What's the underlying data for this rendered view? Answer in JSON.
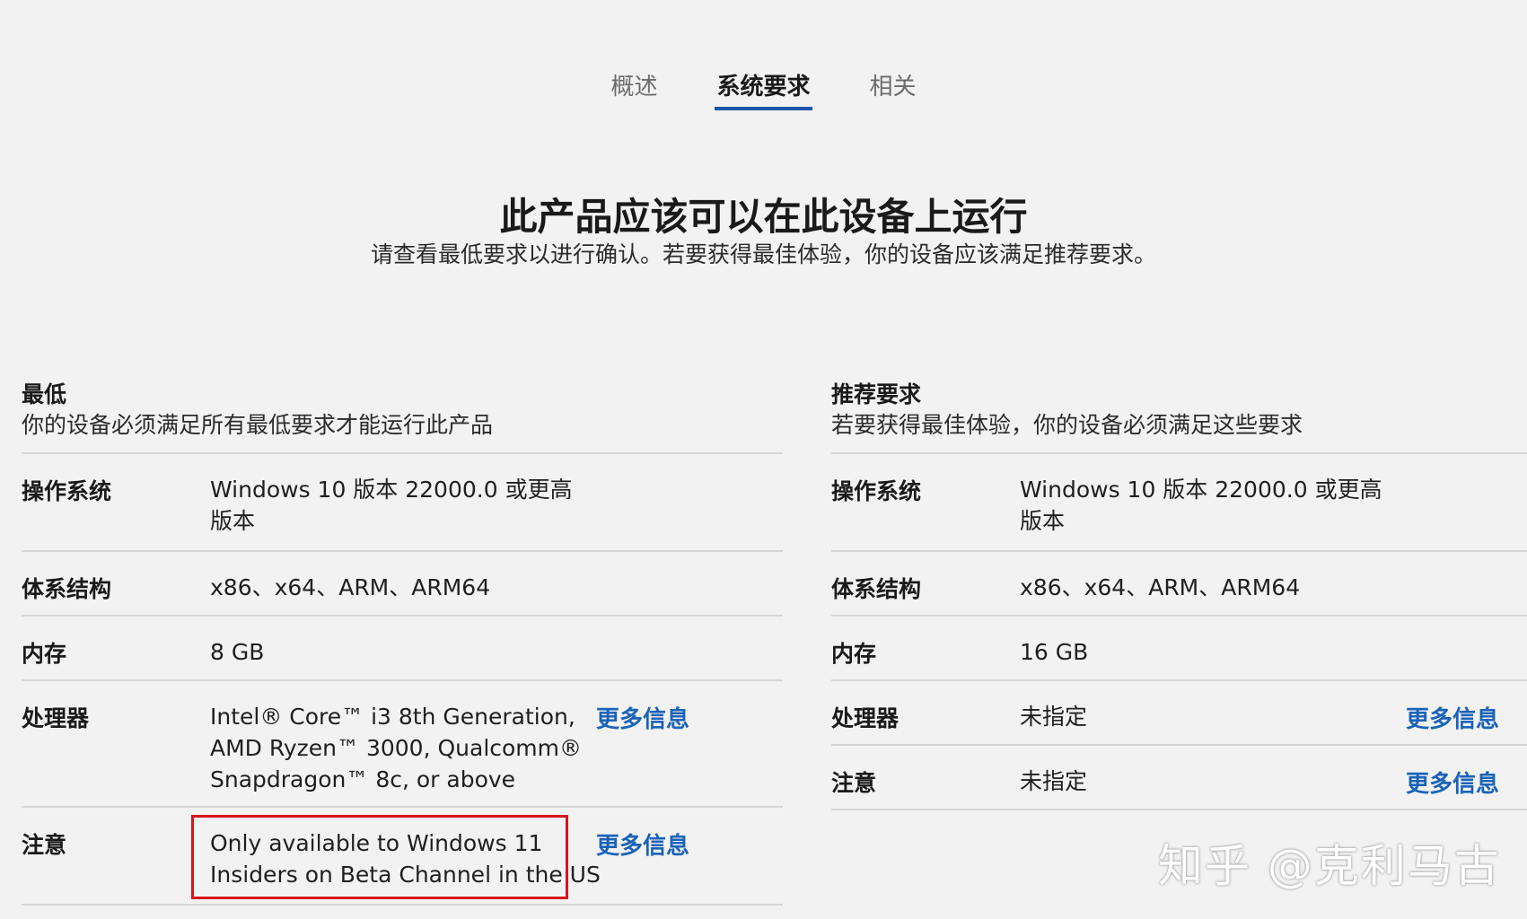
{
  "tabs": [
    {
      "label": "概述",
      "active": false
    },
    {
      "label": "系统要求",
      "active": true
    },
    {
      "label": "相关",
      "active": false
    }
  ],
  "headline": "此产品应该可以在此设备上运行",
  "subhead": "请查看最低要求以进行确认。若要获得最佳体验，你的设备应该满足推荐要求。",
  "minimum": {
    "title": "最低",
    "description": "你的设备必须满足所有最低要求才能运行此产品",
    "rows": {
      "os": {
        "label": "操作系统",
        "value_line1": "Windows 10 版本 22000.0 或更高",
        "value_line2": "版本"
      },
      "arch": {
        "label": "体系结构",
        "value": "x86、x64、ARM、ARM64"
      },
      "memory": {
        "label": "内存",
        "value": "8 GB"
      },
      "processor": {
        "label": "处理器",
        "value_line1": "Intel® Core™ i3 8th Generation,",
        "value_line2": "AMD Ryzen™ 3000, Qualcomm®",
        "value_line3": "Snapdragon™ 8c, or above",
        "more": "更多信息"
      },
      "note": {
        "label": "注意",
        "value_line1": "Only available to Windows 11",
        "value_line2": "Insiders on Beta Channel in the US",
        "more": "更多信息"
      }
    }
  },
  "recommended": {
    "title": "推荐要求",
    "description": "若要获得最佳体验，你的设备必须满足这些要求",
    "rows": {
      "os": {
        "label": "操作系统",
        "value_line1": "Windows 10 版本 22000.0 或更高",
        "value_line2": "版本"
      },
      "arch": {
        "label": "体系结构",
        "value": "x86、x64、ARM、ARM64"
      },
      "memory": {
        "label": "内存",
        "value": "16 GB"
      },
      "processor": {
        "label": "处理器",
        "value": "未指定",
        "more": "更多信息"
      },
      "note": {
        "label": "注意",
        "value": "未指定",
        "more": "更多信息"
      }
    }
  },
  "watermark": "知乎 @克利马古",
  "colors": {
    "accent": "#1a56a8",
    "link": "#1a63b8",
    "highlight": "#d8141c",
    "background": "#f2f2f2"
  }
}
